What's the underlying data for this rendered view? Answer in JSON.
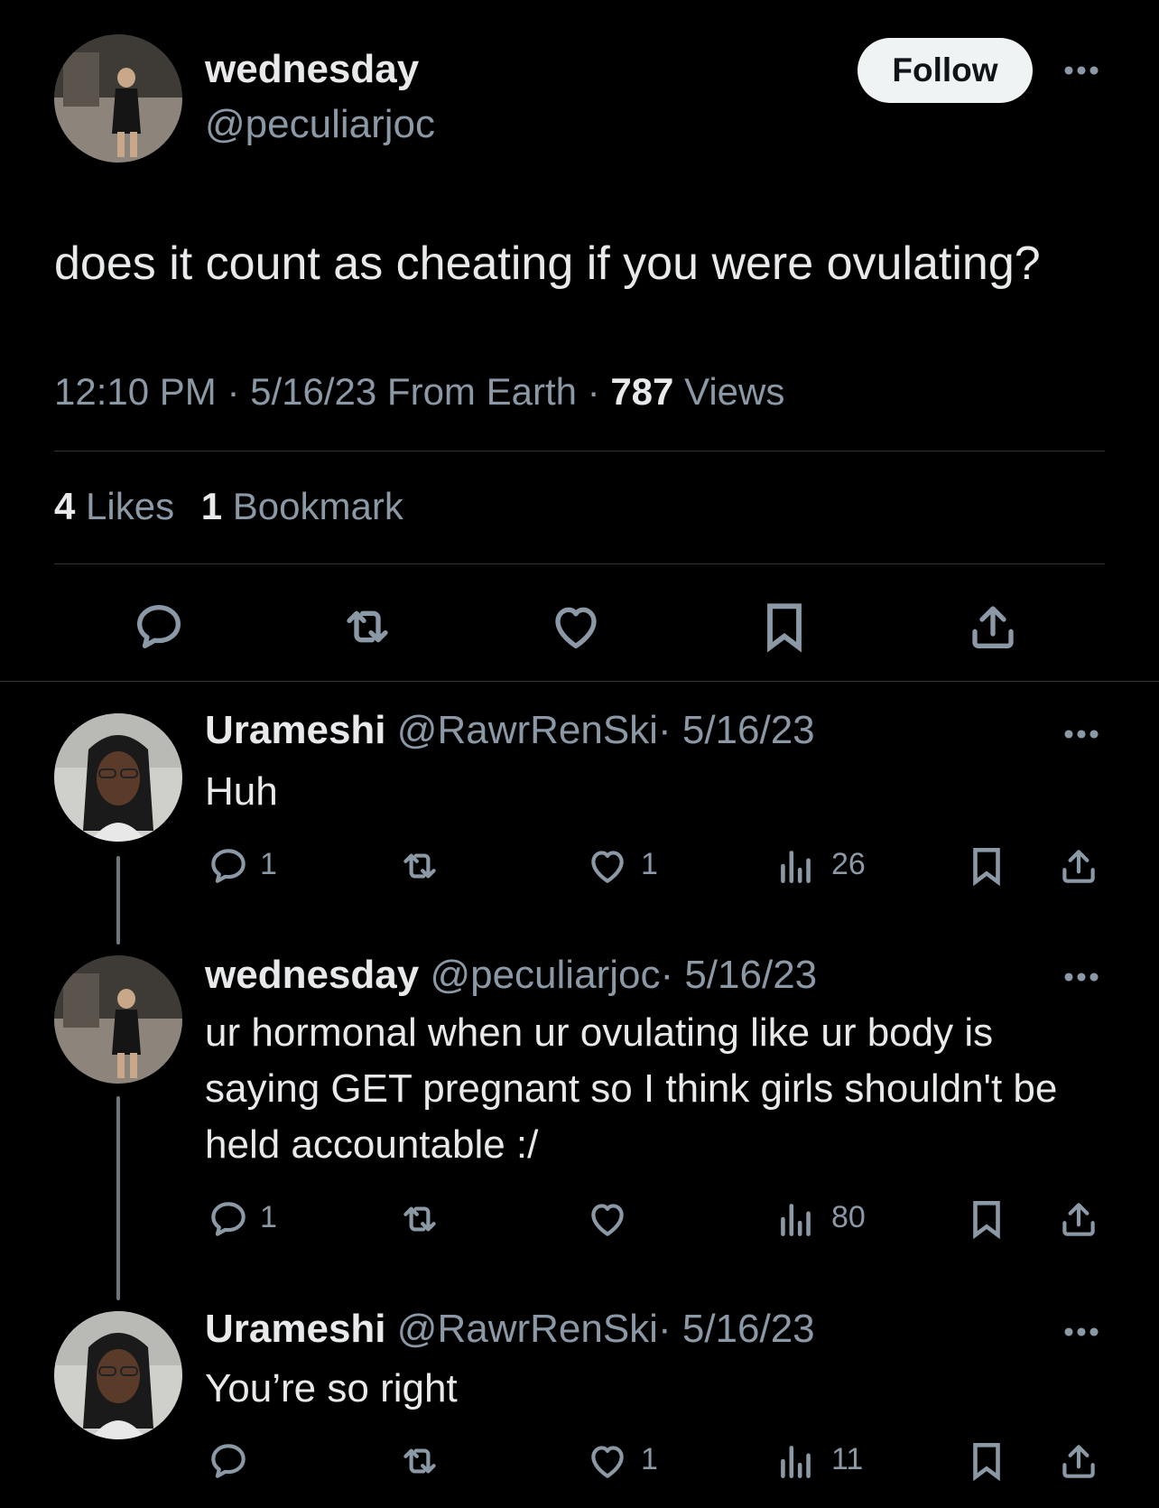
{
  "tweet": {
    "author_name": "wednesday",
    "author_handle": "@peculiarjoc",
    "follow_label": "Follow",
    "text": "does it count as cheating if you were ovulating?",
    "time": "12:10 PM",
    "sep1": "·",
    "date_source": "5/16/23 From Earth",
    "sep2": "·",
    "views_count": "787",
    "views_label": "Views",
    "likes_count": "4",
    "likes_label": "Likes",
    "bookmarks_count": "1",
    "bookmarks_label": "Bookmark"
  },
  "replies": [
    {
      "name": "Urameshi",
      "handle": "@RawrRenSki",
      "date": "· 5/16/23",
      "text": "Huh",
      "reply_count": "1",
      "retweet_count": "",
      "like_count": "1",
      "views_count": "26"
    },
    {
      "name": "wednesday",
      "handle": "@peculiarjoc",
      "date": "· 5/16/23",
      "text": "ur hormonal when ur ovulating like ur body is saying GET pregnant so I think girls shouldn't be held accountable :/",
      "reply_count": "1",
      "retweet_count": "",
      "like_count": "",
      "views_count": "80"
    },
    {
      "name": "Urameshi",
      "handle": "@RawrRenSki",
      "date": "· 5/16/23",
      "text": "You’re so right",
      "reply_count": "",
      "retweet_count": "",
      "like_count": "1",
      "views_count": "11"
    }
  ],
  "icons": {
    "reply": "reply-icon",
    "retweet": "retweet-icon",
    "like": "heart-icon",
    "bookmark": "bookmark-icon",
    "share": "share-icon",
    "views": "analytics-icon",
    "more": "more-icon"
  },
  "colors": {
    "background": "#000000",
    "text": "#e7e9ea",
    "muted": "#8b98a5",
    "divider": "#2f3336",
    "follow_bg": "#eff3f4",
    "follow_text": "#0f1419"
  }
}
